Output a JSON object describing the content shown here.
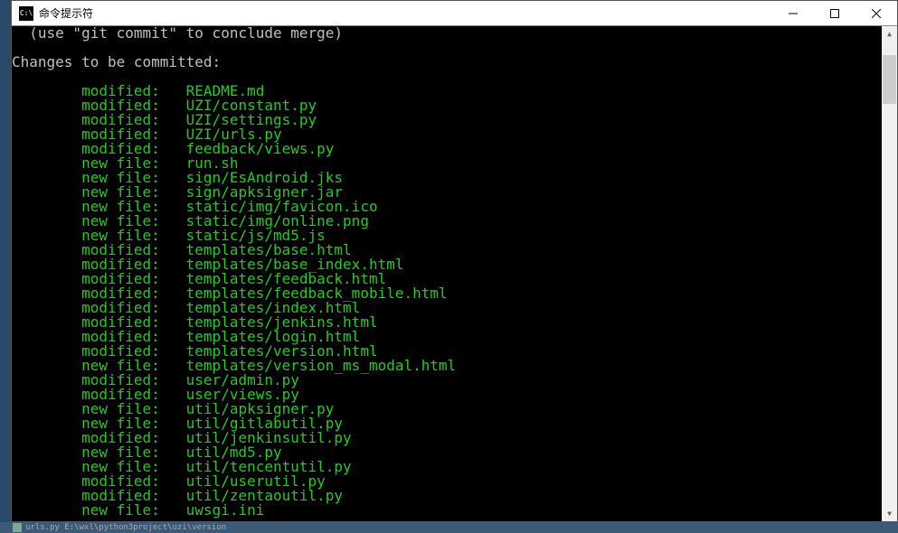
{
  "window": {
    "title": "命令提示符"
  },
  "terminal": {
    "merge_hint": "  (use \"git commit\" to conclude merge)",
    "blank": "",
    "changes_header": "Changes to be committed:",
    "indent": "        ",
    "files": [
      {
        "status": "modified:",
        "path": "README.md"
      },
      {
        "status": "modified:",
        "path": "UZI/constant.py"
      },
      {
        "status": "modified:",
        "path": "UZI/settings.py"
      },
      {
        "status": "modified:",
        "path": "UZI/urls.py"
      },
      {
        "status": "modified:",
        "path": "feedback/views.py"
      },
      {
        "status": "new file:",
        "path": "run.sh"
      },
      {
        "status": "new file:",
        "path": "sign/EsAndroid.jks"
      },
      {
        "status": "new file:",
        "path": "sign/apksigner.jar"
      },
      {
        "status": "new file:",
        "path": "static/img/favicon.ico"
      },
      {
        "status": "new file:",
        "path": "static/img/online.png"
      },
      {
        "status": "new file:",
        "path": "static/js/md5.js"
      },
      {
        "status": "modified:",
        "path": "templates/base.html"
      },
      {
        "status": "modified:",
        "path": "templates/base_index.html"
      },
      {
        "status": "modified:",
        "path": "templates/feedback.html"
      },
      {
        "status": "modified:",
        "path": "templates/feedback_mobile.html"
      },
      {
        "status": "modified:",
        "path": "templates/index.html"
      },
      {
        "status": "modified:",
        "path": "templates/jenkins.html"
      },
      {
        "status": "modified:",
        "path": "templates/login.html"
      },
      {
        "status": "modified:",
        "path": "templates/version.html"
      },
      {
        "status": "new file:",
        "path": "templates/version_ms_modal.html"
      },
      {
        "status": "modified:",
        "path": "user/admin.py"
      },
      {
        "status": "modified:",
        "path": "user/views.py"
      },
      {
        "status": "new file:",
        "path": "util/apksigner.py"
      },
      {
        "status": "new file:",
        "path": "util/gitlabutil.py"
      },
      {
        "status": "modified:",
        "path": "util/jenkinsutil.py"
      },
      {
        "status": "new file:",
        "path": "util/md5.py"
      },
      {
        "status": "new file:",
        "path": "util/tencentutil.py"
      },
      {
        "status": "modified:",
        "path": "util/userutil.py"
      },
      {
        "status": "modified:",
        "path": "util/zentaoutil.py"
      },
      {
        "status": "new file:",
        "path": "uwsgi.ini"
      }
    ]
  },
  "taskbar": {
    "label": "urls.py  E:\\wxl\\python3project\\uzi\\version"
  },
  "titlebar_icon_text": "C:\\"
}
